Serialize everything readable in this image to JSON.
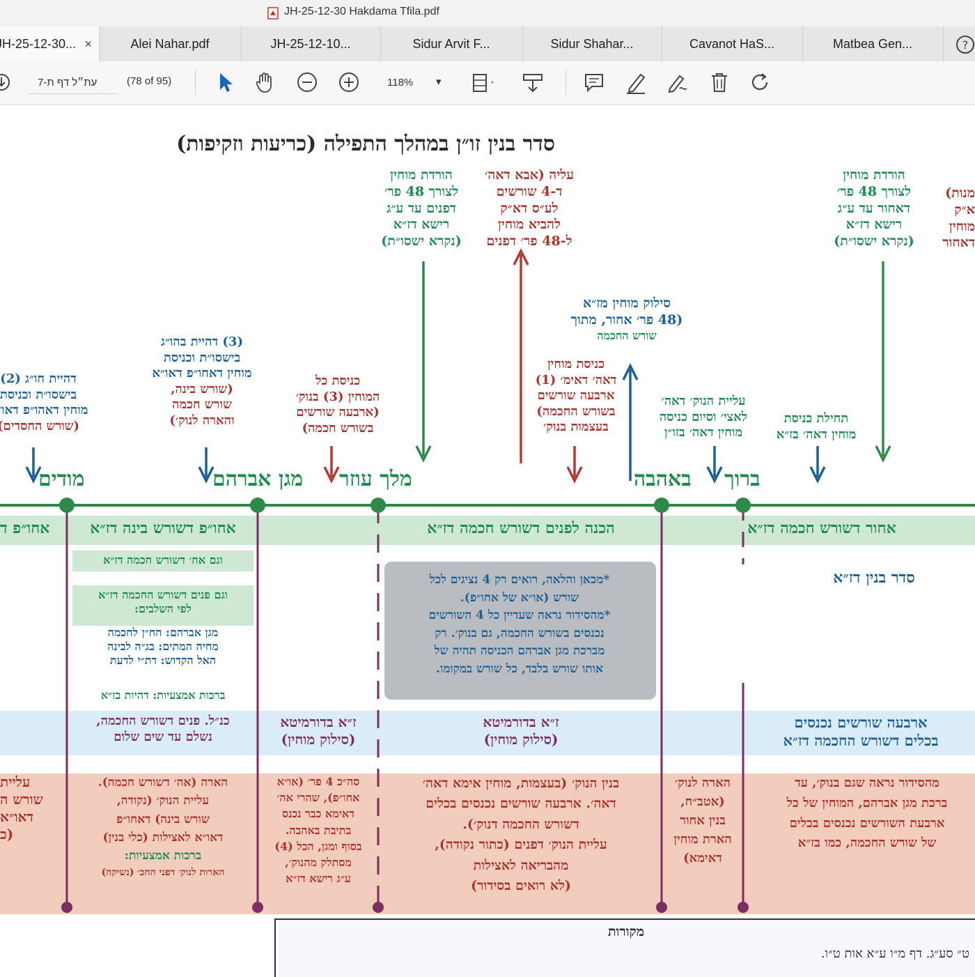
{
  "window": {
    "title": "JH-25-12-30 Hakdama Tfila.pdf"
  },
  "tabs": [
    {
      "label": "JH-25-12-30...",
      "active": true,
      "close": "×"
    },
    {
      "label": "Alei Nahar.pdf"
    },
    {
      "label": "JH-25-12-10..."
    },
    {
      "label": "Sidur Arvit F..."
    },
    {
      "label": "Sidur Shahar..."
    },
    {
      "label": "Cavanot HaS..."
    },
    {
      "label": "Matbea Gen..."
    }
  ],
  "toolbar": {
    "page_input": "עת״ל דף ת-7",
    "page_count": "(78 of 95)",
    "zoom": "118%",
    "icons": [
      "download-icon",
      "cursor-icon",
      "hand-icon",
      "zoom-out-icon",
      "zoom-in-icon",
      "fit-page-icon",
      "scroll-mode-icon",
      "comment-icon",
      "highlight-icon",
      "sign-icon",
      "delete-icon",
      "rotate-icon",
      "help-icon"
    ]
  },
  "doc": {
    "title": "סדר בנין זו״ן במהלך התפילה (כריעות וזקיפות)",
    "words": {
      "modim": "מודים",
      "magen": "מגן אברהם",
      "melech": "מלך עוזר",
      "beahava": "באהבה",
      "baruch": "ברוך"
    },
    "notes": {
      "top_left_green": [
        "הורדת מוחין",
        "לצורך 48 פר׳",
        "דפנים עד ע״ג",
        "רישא דז״א",
        "(נקרא ישסו״ת)"
      ],
      "top_left_red": [
        "עליה (אבא דאה׳",
        "ד-4 שורשים",
        "לע״ס דא״ק",
        "להביא מוחין",
        "ל-48 פר׳ דפנים"
      ],
      "top_right_green": [
        "הורדת מוחין",
        "לצורך 48 פר׳",
        "דאחור עד ע״ג",
        "רישא דז״א",
        "(נקרא ישסו״ת)"
      ],
      "top_edge_red": [
        "מנות)",
        "א״ק",
        "מוחין",
        "דאחור"
      ],
      "siluk": [
        "סילוק מוחין מז״א",
        "(48 פר׳ אחור, מתוך",
        "שורש החכמה"
      ],
      "knisat_imma": [
        "כניסת מוחין",
        "דאה׳ דאימ׳ (1)",
        "ארבעה שורשים",
        "בשורש החכמה)",
        "בעצמות בנוק׳"
      ],
      "knisat_kol": [
        "כניסת כל",
        "המוחין (3) בנוק׳",
        "(ארבעה שורשים",
        "בשורש חכמה)"
      ],
      "hahyat_3_1": "(3) דהיית בהו״ג",
      "hahyat_3_2": "בישסו״ת וכניסת",
      "hahyat_3_3": "מוחין דאחו״פ דאו״א",
      "hahyat_3_4": "(שורש בינה,",
      "hahyat_3_5": "שורש חכמה",
      "hahyat_3_6": "והארה לנוק׳)",
      "hahyat_2": [
        "דהיית חו״ג (2)",
        "בישסו״ת וכניסת",
        "מוחין דאהו״פ דאו״א",
        "(שורש החסדים)"
      ],
      "aliyat_nuk": [
        "עליית הנוק׳ דאה׳",
        "לאצי׳ וסיום כניסה",
        "מוחין דאה׳ בזו״ן"
      ],
      "thilat": [
        "תחילת כניסת",
        "מוחין דאה׳ בז״א"
      ]
    },
    "band_green": {
      "seg1": "אחו״פ דשורש בינה דז״א",
      "seg2": "הכנה לפנים דשורש חכמה דז״א",
      "seg3": "אחור דשורש חכמה דז״א",
      "seg0": "אחו״פ ד"
    },
    "middle": {
      "seder": "סדר בנין דז״א",
      "gam_ah": "וגם אח׳ דשורש חכמה דז״א",
      "gam_panim_1": "וגם פנים דשורש החכמה דז״א",
      "gam_panim_2": "לפי השלבים:",
      "magen_line": "מגן אברהם: הח״ן לחכמה",
      "mehaye_line": "מחיה המתים: בג״ה לבינה",
      "hael_line": "האל הקדוש: דת״י לדעת",
      "brachot_line": "ברכות אמצעיות: דהיות בז״א",
      "gray_box": [
        "*מכאן והלאה, רואים רק 4 נציגים לכל",
        "שורש (או״א של אחו״פ).",
        "*מהסידור נראה שעדיין כל 4 השורשים",
        "נכנסים בשורש החכמה, גם בנוק׳. רק",
        "מברכת מגן אברהם הכניסה תהיה של",
        "אותו שורש בלבד, כל שורש במקומו."
      ]
    },
    "band_blue": {
      "seg1_a": "כנ״ל. פנים דשורש החכמה,",
      "seg1_b": "נשלם עד שים שלום",
      "seg2_a": "ז״א בדורמיטא",
      "seg2_b": "(סילוק מוחין)",
      "seg3_a": "ז״א בדורמיטא",
      "seg3_b": "(סילוק מוחין)",
      "seg4_a": "ארבעה שורשים נכנסים",
      "seg4_b": "בכלים דשורש החכמה דז״א"
    },
    "band_red": {
      "col0": [
        "עליית",
        "שורש ה",
        "דאו״א",
        "(כ"
      ],
      "col1": [
        "הארה (אה׳ דשורש חכמה).",
        "עליית הנוק׳ (נקודה,",
        "שורש בינה) דאחו״פ",
        "דאו״א לאצילות (כלי בנין)",
        "ברכות אמצעיות:",
        "הארות לנוק׳ דפני החכ׳ (נשיקה)"
      ],
      "col2": [
        "סה״כ 4 פר׳ (או״א",
        "אחו״פ), שהרי אה׳",
        "דאימא כבר נכנס",
        "בתיבת באהבה.",
        "בסוף ומגן, הכל (4)",
        "מסתלק מהנוק׳,",
        "ע״ג רישא דז״א"
      ],
      "col3": [
        "בנין הנוק׳ (בעצמות, מוחין אימא דאה׳",
        "דאה׳. ארבעה שורשים נכנסים בכלים",
        "דשורש החכמה דנוק׳).",
        "עליית הנוק׳ דפנים (כתור נקודה),",
        "מהבריאה לאצילות",
        "(לא רואים בסידור)"
      ],
      "col4": [
        "הארה לנוק׳",
        "(אטב״ח,",
        "בנין אחור",
        "הארת מוחין",
        "דאימא)"
      ],
      "col5": [
        "מהסידור נראה שגם בנוק׳, עד",
        "ברכת מגן אברהם, המוחין של כל",
        "ארבעת השורשים נכנסים בכלים",
        "של שורש החכמה, כמו בז״א"
      ]
    },
    "sources": {
      "title": "מקורות",
      "line1": "ט״ סע״ג. דף מ״ו ע״א אות ט״ו.",
      "line2": ""
    }
  }
}
